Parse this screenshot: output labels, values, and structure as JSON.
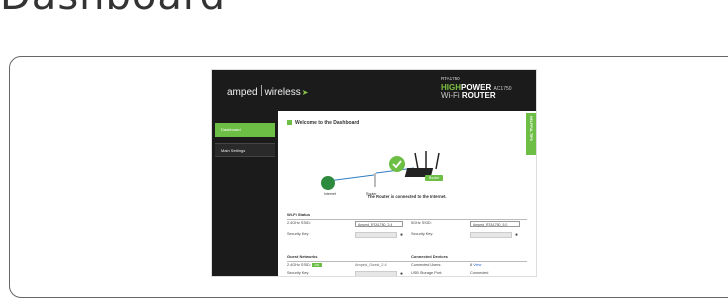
{
  "page_title": "Dashboard",
  "header": {
    "brand": "amped",
    "brand2": "wireless",
    "model": "RTA1750",
    "hp_line1a": "HIGH",
    "hp_line1b": "POWER",
    "hp_ac": "AC1750",
    "hp_line2a": "Wi-Fi",
    "hp_line2b": "ROUTER"
  },
  "sidebar": {
    "items": [
      {
        "label": "Dashboard"
      },
      {
        "label": "Main Settings"
      }
    ]
  },
  "main": {
    "welcome": "Welcome to the Dashboard",
    "helpful_tips": "HELPFUL TIPS",
    "diagram": {
      "internet_label": "Internet",
      "router_label": "Router",
      "router_button": "Router",
      "status_text": "The Router is connected to the Internet."
    },
    "wifi_status": {
      "title": "Wi-Fi Status",
      "ssid24_label": "2.4GHz SSID:",
      "ssid24_value": "Amped_RTA1750_2.4",
      "ssid5_label": "5GHz SSID:",
      "ssid5_value": "Amped_RTA1750_5.0",
      "key_label": "Security Key:",
      "key5_label": "Security Key:"
    },
    "guest": {
      "title": "Guest Networks",
      "ssid_label": "2.4GHz SSID:",
      "toggle": "ON",
      "ssid_value": "Amped_Guest_2.4",
      "key_label": "Security Key:"
    },
    "devices": {
      "title": "Connected Devices",
      "users_label": "Connected Users:",
      "users_value": "8",
      "users_link": "View",
      "usb_label": "USB Storage Port:",
      "usb_value": "Connected"
    }
  },
  "colors": {
    "accent": "#6cbe45",
    "header_bg": "#1b1b1b",
    "internet_globe": "#2e8b3e"
  }
}
